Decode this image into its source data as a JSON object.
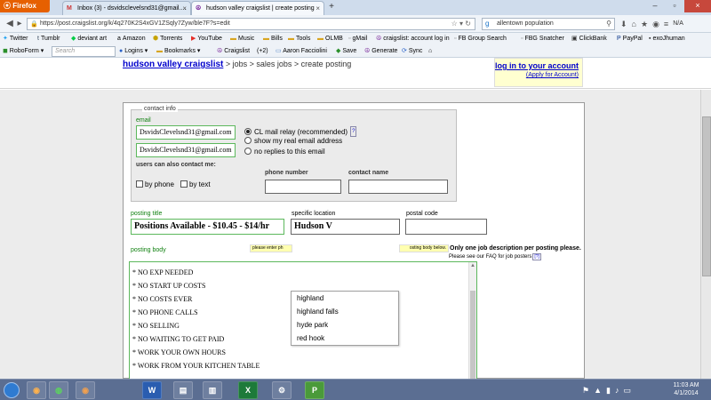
{
  "browser": {
    "app_name": "Firefox",
    "tabs": [
      {
        "label": "Inbox (3) - dsvidsclevelsnd31@gmail....",
        "icon": "M"
      },
      {
        "label": "hudson valley craigslist | create posting",
        "icon": "☮"
      }
    ],
    "url": "https://post.craigslist.org/k/4q270K2S4xGV1ZSqly7Zyw/ble7F?s=edit",
    "search_value": "allentown population",
    "status_text": "N/A"
  },
  "bookmarks": [
    "Twitter",
    "Tumblr",
    "deviant art",
    "Amazon",
    "Torrents",
    "YouTube",
    "Music",
    "Bills",
    "Tools",
    "OLMB",
    "gMail",
    "craigslist: account log in",
    "FB Group Search",
    "FBG Snatcher",
    "ClickBank",
    "PayPal",
    "exoJhuman"
  ],
  "toolbar2": {
    "roboform": "RoboForm",
    "search_placeholder": "Search",
    "logins": "Logins",
    "bookmarks_menu": "Bookmarks",
    "craigslist": "Craigslist",
    "craigslist_count": "(+2)",
    "user": "Aaron Facciolini",
    "save": "Save",
    "generate": "Generate",
    "sync": "Sync"
  },
  "page": {
    "site_name": "hudson valley craigslist",
    "breadcrumb_rest": " > jobs > sales jobs > create posting",
    "login_link": "log in to your account",
    "apply_link": "(Apply for Account)"
  },
  "form": {
    "contact_legend": "contact info",
    "email_label": "email",
    "email_value": "DsvidsClevelsnd31@gmail.com",
    "email_confirm_value": "DsvidsClevelsnd31@gmail.com",
    "relay_options": [
      "CL mail relay (recommended)",
      "show my real email address",
      "no replies to this email"
    ],
    "relay_help": "?",
    "contact_methods_label": "users can also contact me:",
    "by_phone": "by phone",
    "by_text": "by text",
    "phone_label": "phone number",
    "contact_name_label": "contact name",
    "posting_title_label": "posting title",
    "posting_title_value": "Positions Available - $10.45 - $14/hr",
    "specific_location_label": "specific location",
    "specific_location_value": "Hudson V",
    "postal_code_label": "postal code",
    "posting_body_label": "posting body",
    "please_enter_text": "please enter ph",
    "posting_body_below_text": "osting body below.",
    "one_job_notice": "Only one job description per posting please.",
    "faq_notice": "Please see our FAQ for job posters",
    "faq_help": "[?]",
    "body_lines": [
      "* NO EXP NEEDED",
      "* NO START UP COSTS",
      "* NO COSTS EVER",
      "* NO PHONE CALLS",
      "* NO SELLING",
      "* NO WAITING TO GET PAID",
      "* WORK YOUR OWN HOURS",
      "* WORK FROM YOUR KITCHEN TABLE"
    ]
  },
  "autocomplete": [
    "highland",
    "highland falls",
    "hyde park",
    "red hook"
  ],
  "taskbar": {
    "clock_time": "11:03 AM",
    "clock_date": "4/1/2014"
  }
}
